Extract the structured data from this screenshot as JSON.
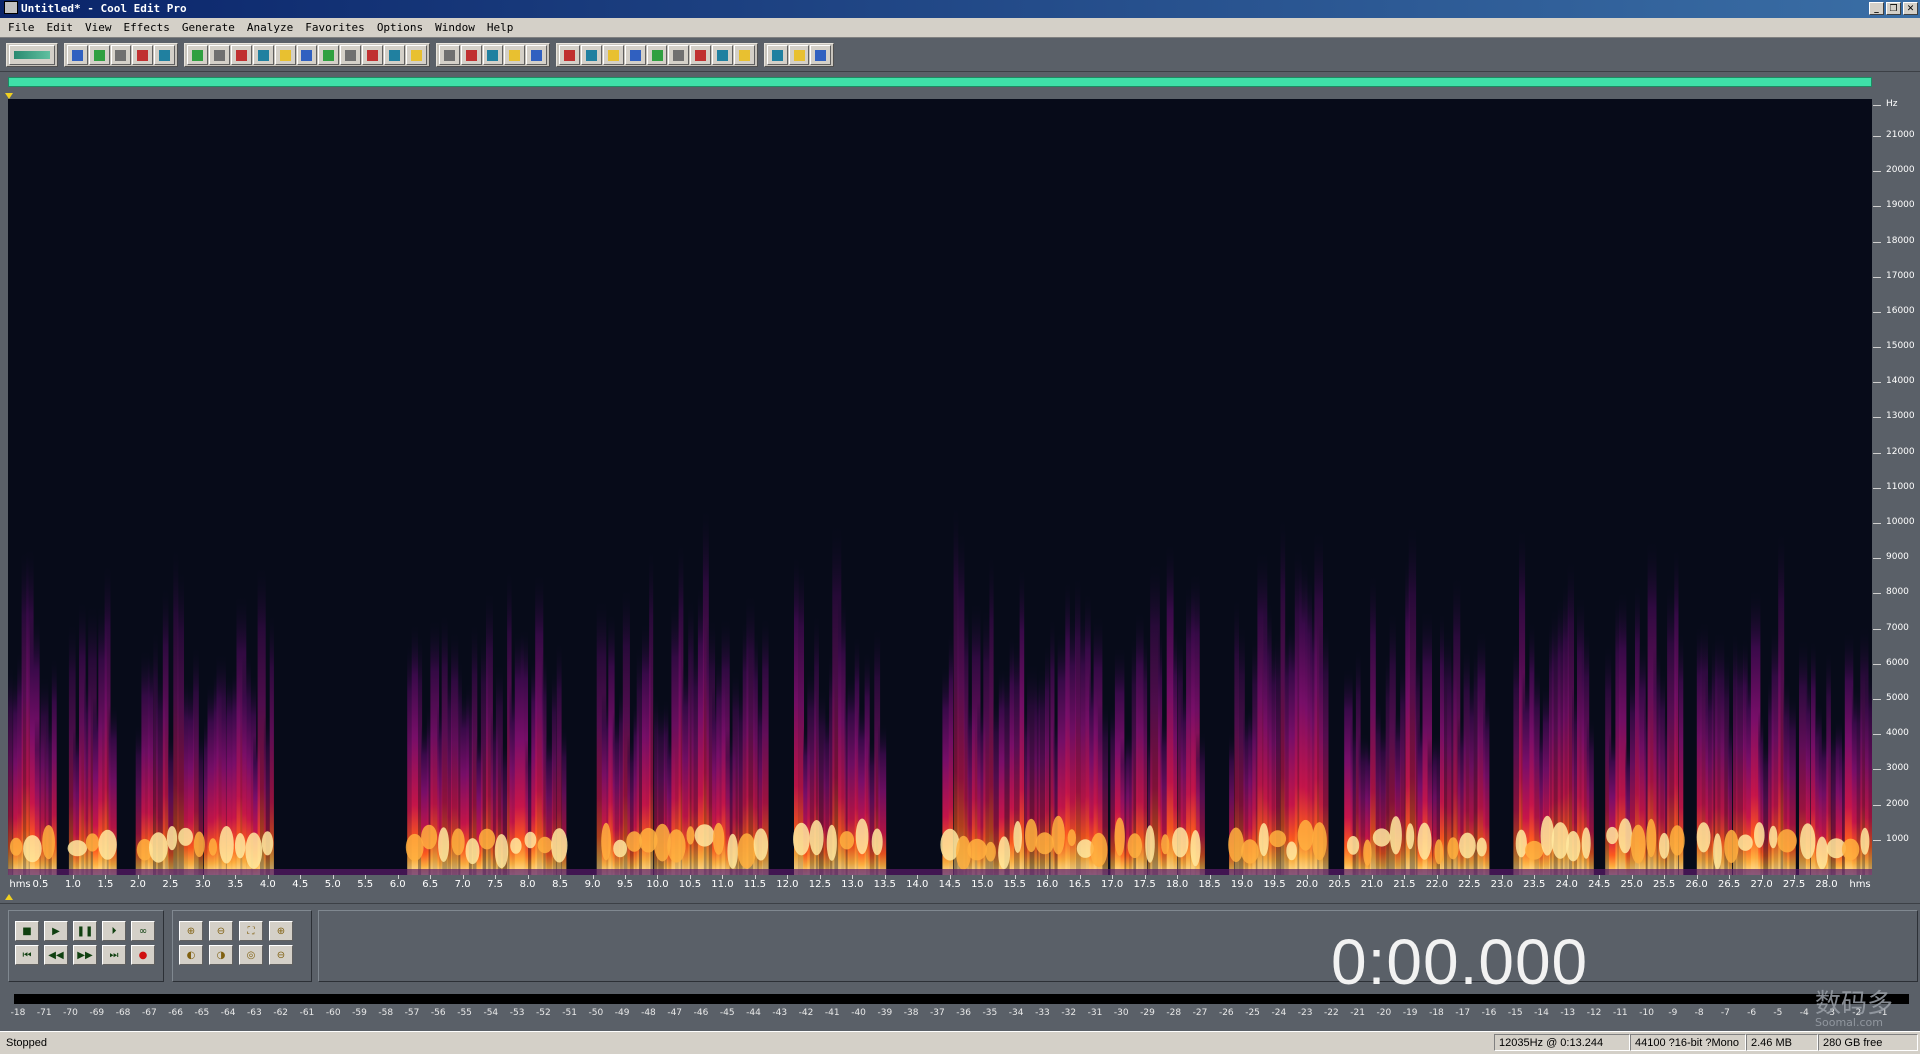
{
  "window": {
    "title": "Untitled* - Cool Edit Pro"
  },
  "menu": [
    "File",
    "Edit",
    "View",
    "Effects",
    "Generate",
    "Analyze",
    "Favorites",
    "Options",
    "Window",
    "Help"
  ],
  "toolbar": {
    "groups": [
      [
        "mode-switch"
      ],
      [
        "new-file",
        "open-file",
        "save-file",
        "save-as",
        "close-file"
      ],
      [
        "undo",
        "redo",
        "repeat",
        "copy",
        "copy-new",
        "cut",
        "paste",
        "paste-new",
        "mix-paste",
        "trim",
        "mix-paste-2"
      ],
      [
        "spectral-view",
        "waveform-view",
        "settings-a",
        "settings-b",
        "settings-c"
      ],
      [
        "info",
        "cue-list",
        "play-list",
        "play-preview",
        "zoom-view",
        "time-display",
        "frame-display",
        "spectral-display",
        "blank-display"
      ],
      [
        "settings",
        "script",
        "help"
      ]
    ]
  },
  "spectrogram": {
    "frequency_labels": [
      "Hz",
      "21000",
      "20000",
      "19000",
      "18000",
      "17000",
      "16000",
      "15000",
      "14000",
      "13000",
      "12000",
      "11000",
      "10000",
      "9000",
      "8000",
      "7000",
      "6000",
      "5000",
      "4000",
      "3000",
      "2000",
      "1000"
    ],
    "time_labels": [
      "hms",
      "0.5",
      "1.0",
      "1.5",
      "2.0",
      "2.5",
      "3.0",
      "3.5",
      "4.0",
      "4.5",
      "5.0",
      "5.5",
      "6.0",
      "6.5",
      "7.0",
      "7.5",
      "8.0",
      "8.5",
      "9.0",
      "9.5",
      "10.0",
      "10.5",
      "11.0",
      "11.5",
      "12.0",
      "12.5",
      "13.0",
      "13.5",
      "14.0",
      "14.5",
      "15.0",
      "15.5",
      "16.0",
      "16.5",
      "17.0",
      "17.5",
      "18.0",
      "18.5",
      "19.0",
      "19.5",
      "20.0",
      "20.5",
      "21.0",
      "21.5",
      "22.0",
      "22.5",
      "23.0",
      "23.5",
      "24.0",
      "24.5",
      "25.0",
      "25.5",
      "26.0",
      "26.5",
      "27.0",
      "27.5",
      "28.0",
      "hms"
    ],
    "colors": {
      "background": "#070b19",
      "low": "#3a0a4a",
      "mid": "#b0124a",
      "high": "#ff5a1e",
      "peak": "#ffe9a0"
    },
    "bursts": [
      [
        0.0,
        0.75,
        1.0
      ],
      [
        0.95,
        1.65,
        1.0
      ],
      [
        2.0,
        4.1,
        0.95
      ],
      [
        6.15,
        8.6,
        0.95
      ],
      [
        9.1,
        11.7,
        1.0
      ],
      [
        12.1,
        13.5,
        0.95
      ],
      [
        14.4,
        16.9,
        1.0
      ],
      [
        17.0,
        18.4,
        0.9
      ],
      [
        18.8,
        20.3,
        1.0
      ],
      [
        20.6,
        22.8,
        0.95
      ],
      [
        23.2,
        24.4,
        1.0
      ],
      [
        24.6,
        25.8,
        0.9
      ],
      [
        26.0,
        27.5,
        0.95
      ],
      [
        27.6,
        28.7,
        0.9
      ]
    ],
    "duration_s": 28.7
  },
  "transport": {
    "buttons_row1": [
      "stop",
      "play",
      "pause",
      "play-to-end",
      "loop"
    ],
    "buttons_row2": [
      "go-to-start",
      "rewind",
      "fast-forward",
      "go-to-end",
      "record"
    ],
    "zoom_row1": [
      "zoom-in-horizontal",
      "zoom-out-horizontal",
      "zoom-full",
      "zoom-in-vertical"
    ],
    "zoom_row2": [
      "zoom-to-left",
      "zoom-to-right",
      "zoom-selection",
      "zoom-out-vertical"
    ],
    "time": "0:00.000"
  },
  "levels": {
    "db_labels": [
      "-18",
      "-71",
      "-70",
      "-69",
      "-68",
      "-67",
      "-66",
      "-65",
      "-64",
      "-63",
      "-62",
      "-61",
      "-60",
      "-59",
      "-58",
      "-57",
      "-56",
      "-55",
      "-54",
      "-53",
      "-52",
      "-51",
      "-50",
      "-49",
      "-48",
      "-47",
      "-46",
      "-45",
      "-44",
      "-43",
      "-42",
      "-41",
      "-40",
      "-39",
      "-38",
      "-37",
      "-36",
      "-35",
      "-34",
      "-33",
      "-32",
      "-31",
      "-30",
      "-29",
      "-28",
      "-27",
      "-26",
      "-25",
      "-24",
      "-23",
      "-22",
      "-21",
      "-20",
      "-19",
      "-18",
      "-17",
      "-16",
      "-15",
      "-14",
      "-13",
      "-12",
      "-11",
      "-10",
      "-9",
      "-8",
      "-7",
      "-6",
      "-5",
      "-4",
      "-3",
      "-2",
      "-1"
    ]
  },
  "status": {
    "state": "Stopped",
    "cursor": "12035Hz @  0:13.244",
    "format": "44100 ?16-bit ?Mono",
    "size": "2.46 MB",
    "free": "280 GB free"
  },
  "watermark": {
    "text": "数码多",
    "sub": "Soomal.com"
  }
}
